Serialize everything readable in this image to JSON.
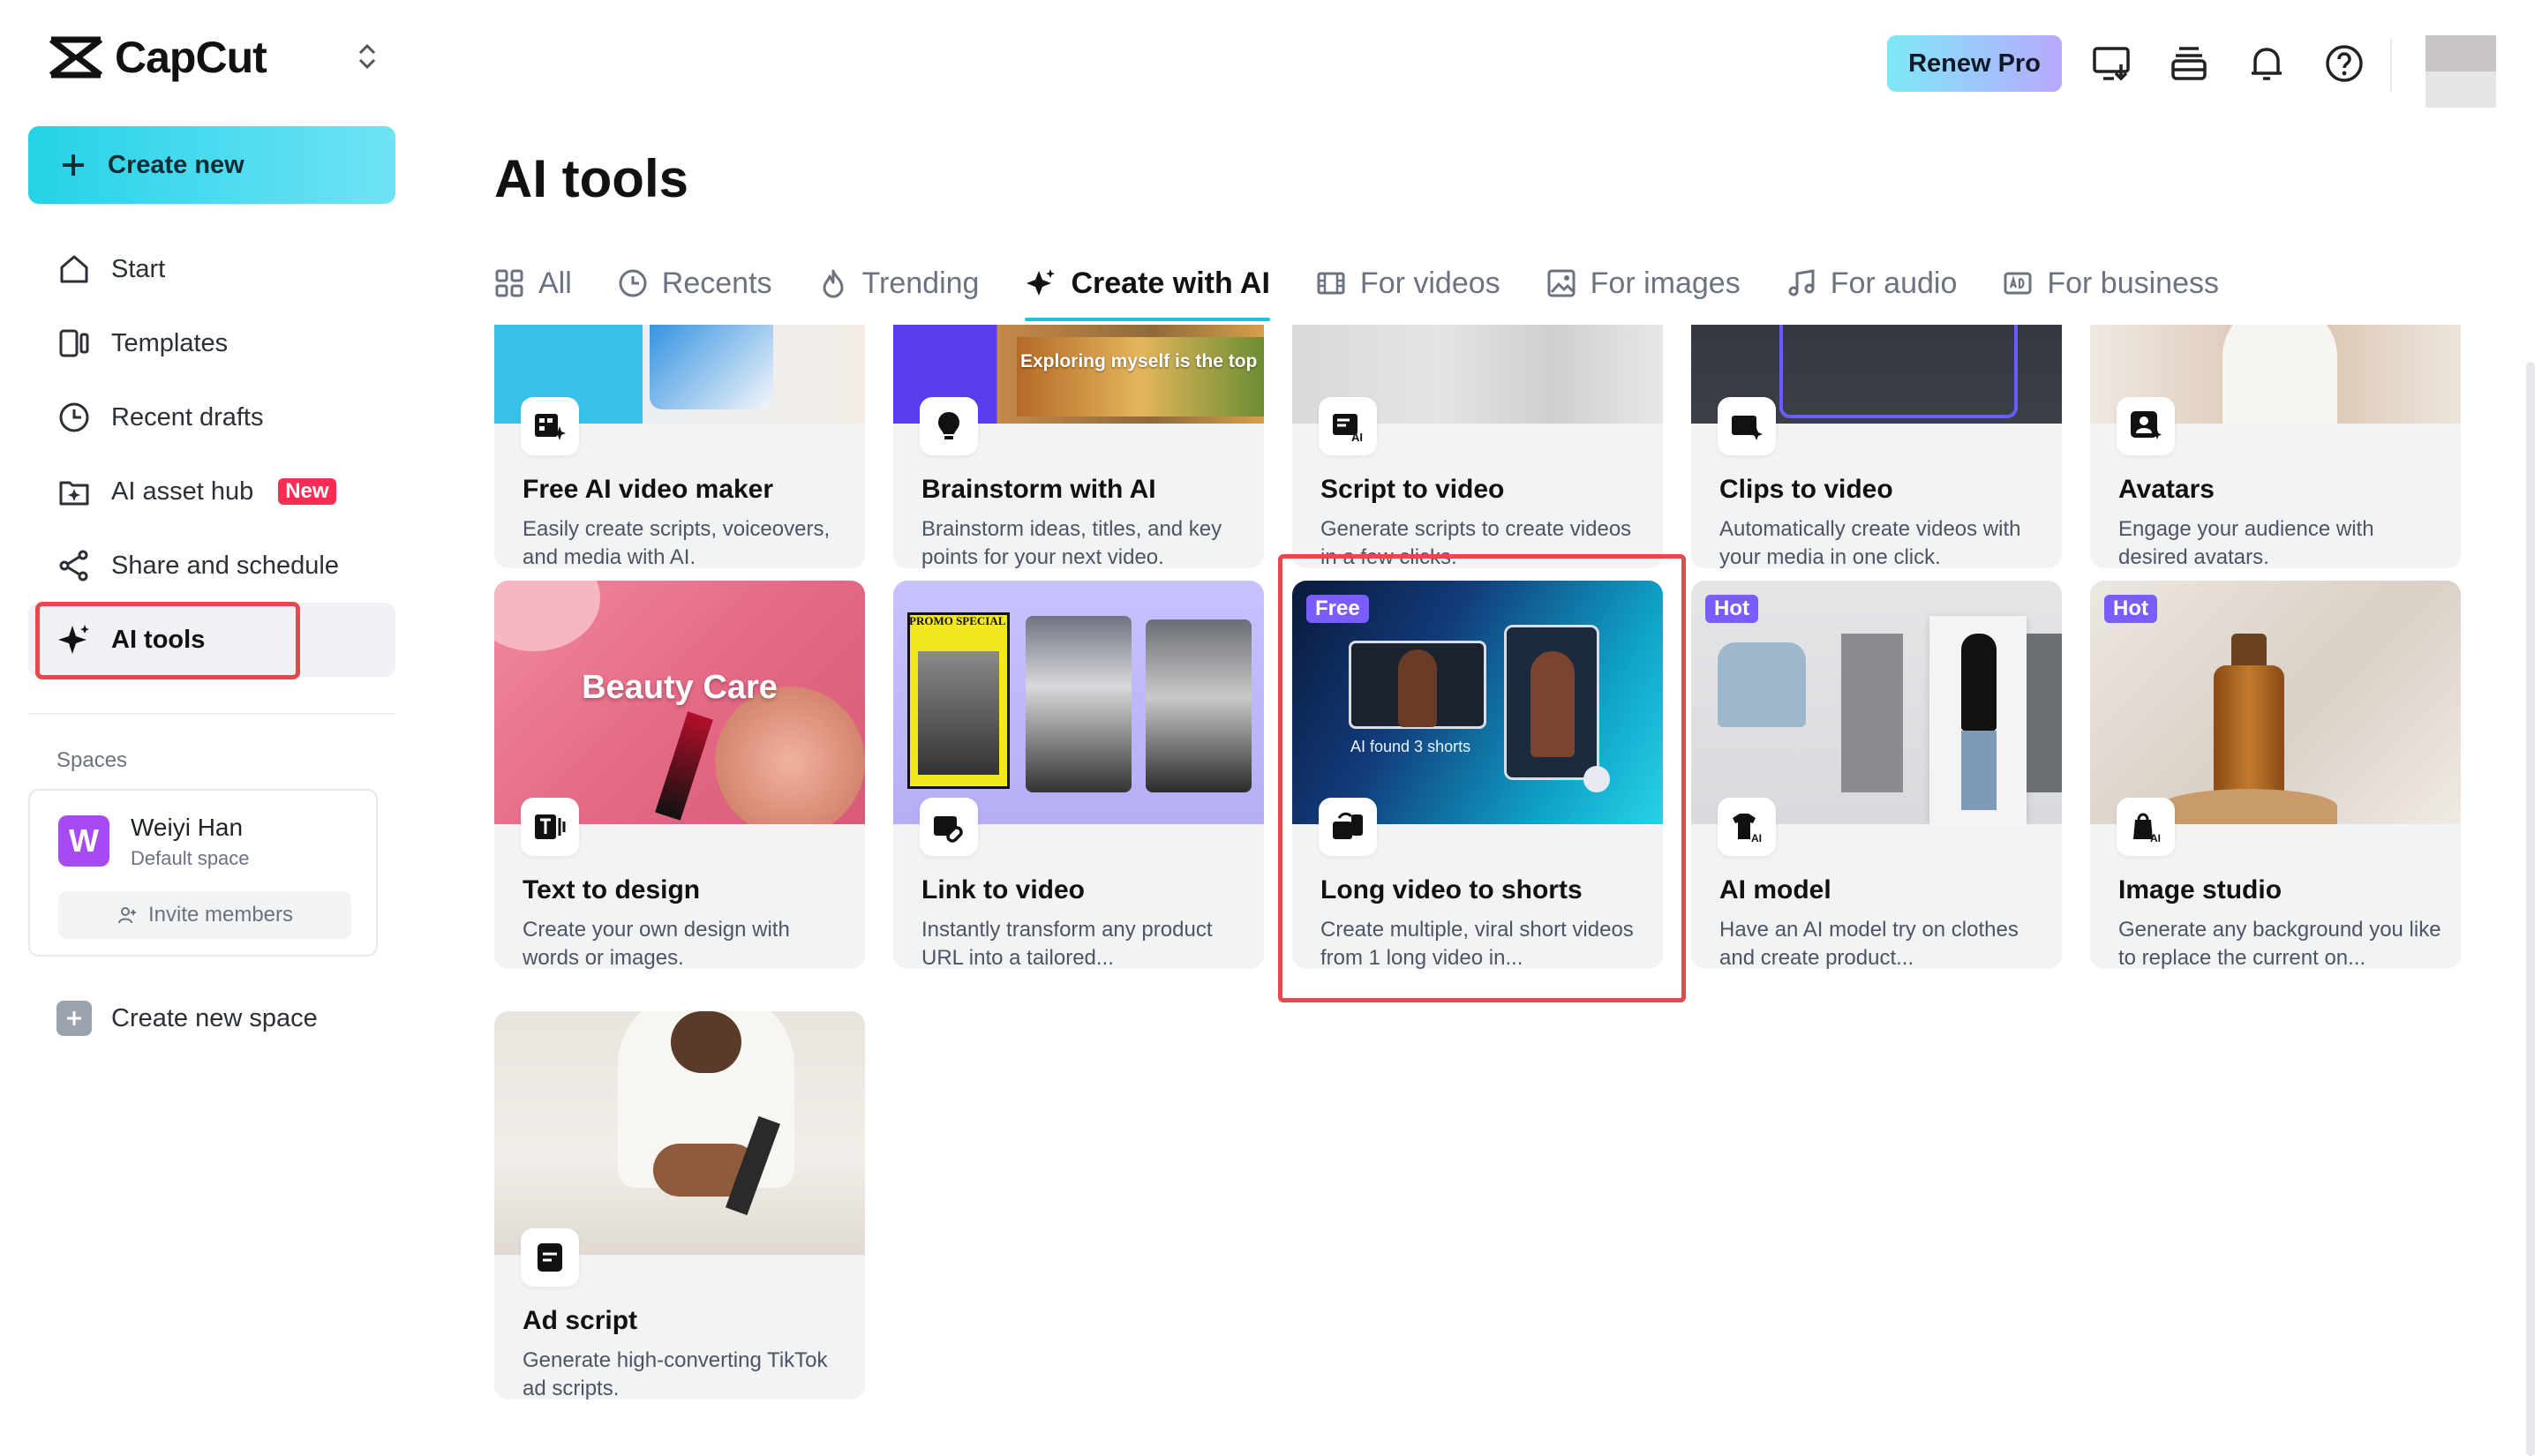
{
  "app": {
    "name": "CapCut"
  },
  "sidebar": {
    "create_new_label": "Create new",
    "items": [
      {
        "label": "Start",
        "icon": "home-icon"
      },
      {
        "label": "Templates",
        "icon": "templates-icon"
      },
      {
        "label": "Recent drafts",
        "icon": "clock-icon"
      },
      {
        "label": "AI asset hub",
        "icon": "asset-hub-icon",
        "badge": "New"
      },
      {
        "label": "Share and schedule",
        "icon": "share-icon"
      },
      {
        "label": "AI tools",
        "icon": "sparkle-icon",
        "active": true
      }
    ],
    "spaces_label": "Spaces",
    "space": {
      "avatar_letter": "W",
      "name": "Weiyi Han",
      "subtitle": "Default space",
      "invite_label": "Invite members"
    },
    "create_space_label": "Create new space"
  },
  "header": {
    "renew_label": "Renew Pro",
    "icons": [
      "screen-download-icon",
      "storage-icon",
      "bell-icon",
      "help-icon"
    ]
  },
  "main": {
    "title": "AI tools",
    "tabs": [
      {
        "label": "All",
        "icon": "grid-icon"
      },
      {
        "label": "Recents",
        "icon": "clock-icon"
      },
      {
        "label": "Trending",
        "icon": "flame-icon"
      },
      {
        "label": "Create with AI",
        "icon": "sparkle-icon",
        "active": true
      },
      {
        "label": "For videos",
        "icon": "film-icon"
      },
      {
        "label": "For images",
        "icon": "image-icon"
      },
      {
        "label": "For audio",
        "icon": "music-icon"
      },
      {
        "label": "For business",
        "icon": "ad-icon"
      }
    ],
    "cards": [
      {
        "title": "Free AI video maker",
        "desc": "Easily create scripts, voiceovers, and media with AI.",
        "icon": "ai-video-icon"
      },
      {
        "title": "Brainstorm with AI",
        "desc": "Brainstorm ideas, titles, and key points for your next video.",
        "icon": "lightbulb-icon",
        "thumb_text": "Exploring myself is the top"
      },
      {
        "title": "Script to video",
        "desc": "Generate scripts to create videos in a few clicks.",
        "icon": "script-icon"
      },
      {
        "title": "Clips to video",
        "desc": "Automatically create videos with your media in one click.",
        "icon": "clips-icon"
      },
      {
        "title": "Avatars",
        "desc": "Engage your audience with desired avatars.",
        "icon": "avatar-icon"
      },
      {
        "title": "Text to design",
        "desc": "Create your own design with words or images.",
        "icon": "text-design-icon",
        "thumb_text": "Beauty Care"
      },
      {
        "title": "Link to video",
        "desc": "Instantly transform any product URL into a tailored...",
        "icon": "link-icon",
        "thumb_text": "PROMO SPECIAL"
      },
      {
        "title": "Long video to shorts",
        "desc": "Create multiple, viral short videos from 1 long video in...",
        "icon": "shorts-icon",
        "tag": "Free",
        "thumb_text": "AI found 3 shorts"
      },
      {
        "title": "AI model",
        "desc": "Have an AI model try on clothes and create product...",
        "icon": "ai-model-icon",
        "tag": "Hot"
      },
      {
        "title": "Image studio",
        "desc": "Generate any background you like to replace the current on...",
        "icon": "image-studio-icon",
        "tag": "Hot"
      },
      {
        "title": "Ad script",
        "desc": "Generate high-converting TikTok ad scripts.",
        "icon": "ad-script-icon"
      }
    ]
  },
  "colors": {
    "accent": "#1fc3d8",
    "highlight": "#e5484d",
    "new_badge": "#fe2c55",
    "tag": "#7b5cff"
  }
}
